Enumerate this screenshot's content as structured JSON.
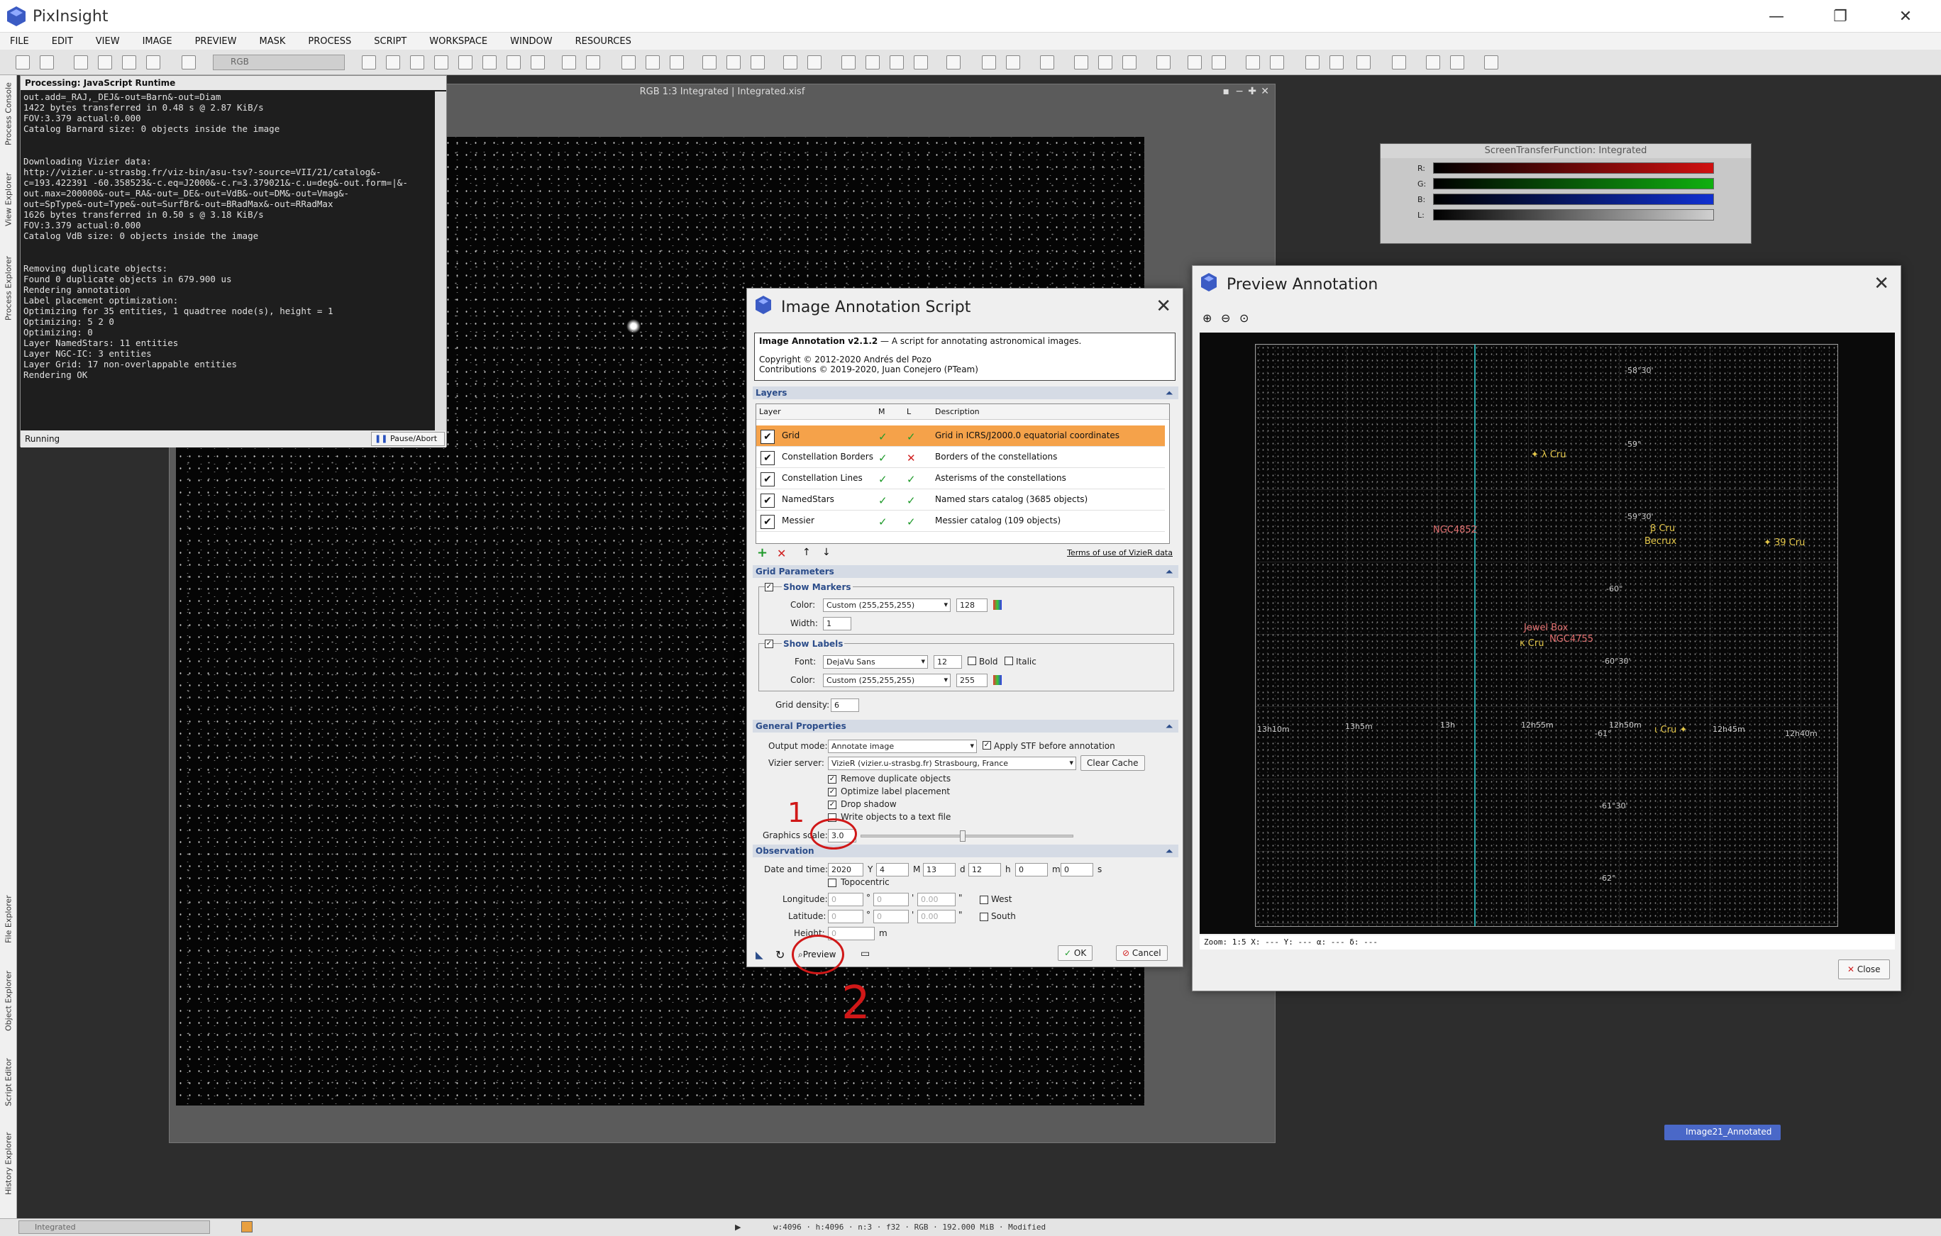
{
  "app": {
    "title": "PixInsight",
    "min": "—",
    "restore": "❐",
    "close": "✕"
  },
  "menu": [
    "FILE",
    "EDIT",
    "VIEW",
    "IMAGE",
    "PREVIEW",
    "MASK",
    "PROCESS",
    "SCRIPT",
    "WORKSPACE",
    "WINDOW",
    "RESOURCES"
  ],
  "toolbar": {
    "image_combo": "RGB"
  },
  "side_tabs": [
    "Process Console",
    "View Explorer",
    "Process Explorer",
    "File Explorer",
    "Object Explorer",
    "Script Editor",
    "History Explorer"
  ],
  "image_window": {
    "title": "RGB 1:3 Integrated | Integrated.xisf"
  },
  "console": {
    "title": "Processing: JavaScript Runtime",
    "text": "out.add=_RAJ,_DEJ&-out=Barn&-out=Diam\n1422 bytes transferred in 0.48 s @ 2.87 KiB/s\nFOV:3.379 actual:0.000\nCatalog Barnard size: 0 objects inside the image\n\n\nDownloading Vizier data:\nhttp://vizier.u-strasbg.fr/viz-bin/asu-tsv?-source=VII/21/catalog&-\nc=193.422391 -60.358523&-c.eq=J2000&-c.r=3.379021&-c.u=deg&-out.form=|&-\nout.max=200000&-out=_RA&-out=_DE&-out=VdB&-out=DM&-out=Vmag&-\nout=SpType&-out=Type&-out=SurfBr&-out=BRadMax&-out=RRadMax\n1626 bytes transferred in 0.50 s @ 3.18 KiB/s\nFOV:3.379 actual:0.000\nCatalog VdB size: 0 objects inside the image\n\n\nRemoving duplicate objects:\nFound 0 duplicate objects in 679.900 us\nRendering annotation\nLabel placement optimization:\nOptimizing for 35 entities, 1 quadtree node(s), height = 1\nOptimizing: 5 2 0\nOptimizing: 0\nLayer NamedStars: 11 entities\nLayer NGC-IC: 3 entities\nLayer Grid: 17 non-overlappable entities\nRendering OK",
    "status": "Running",
    "pause_label": "Pause/Abort"
  },
  "stf": {
    "title": "ScreenTransferFunction: Integrated",
    "channels": [
      "R:",
      "G:",
      "B:",
      "L:"
    ],
    "colors": [
      "#d01010",
      "#10b010",
      "#1030d0",
      "#d0d0d0"
    ]
  },
  "dialog": {
    "title": "Image Annotation Script",
    "close": "✕",
    "info_title": "Image Annotation v2.1.2",
    "info_desc": " — A script for annotating astronomical images.",
    "copyright1": "Copyright © 2012-2020 Andrés del Pozo",
    "copyright2": "Contributions © 2019-2020, Juan Conejero (PTeam)",
    "layers_hdr": "Layers",
    "cols": {
      "layer": "Layer",
      "m": "M",
      "l": "L",
      "desc": "Description"
    },
    "layers": [
      {
        "name": "Grid",
        "m": "✓",
        "l": "✓",
        "desc": "Grid in ICRS/J2000.0 equatorial coordinates"
      },
      {
        "name": "Constellation Borders",
        "m": "✓",
        "l": "✕",
        "desc": "Borders of the constellations"
      },
      {
        "name": "Constellation Lines",
        "m": "✓",
        "l": "✓",
        "desc": "Asterisms of the constellations"
      },
      {
        "name": "NamedStars",
        "m": "✓",
        "l": "✓",
        "desc": "Named stars catalog (3685 objects)"
      },
      {
        "name": "Messier",
        "m": "✓",
        "l": "✓",
        "desc": "Messier catalog (109 objects)"
      }
    ],
    "terms": "Terms of use of VizieR data",
    "grid_hdr": "Grid Parameters",
    "show_markers": "Show Markers",
    "color_lbl": "Color:",
    "marker_color": "Custom (255,255,255)",
    "marker_alpha": "128",
    "width_lbl": "Width:",
    "width_val": "1",
    "show_labels": "Show Labels",
    "font_lbl": "Font:",
    "font_val": "DejaVu Sans",
    "font_size": "12",
    "bold": "Bold",
    "italic": "Italic",
    "label_color": "Custom (255,255,255)",
    "label_alpha": "255",
    "density_lbl": "Grid density:",
    "density_val": "6",
    "gen_hdr": "General Properties",
    "output_lbl": "Output mode:",
    "output_val": "Annotate image",
    "apply_stf": "Apply STF before annotation",
    "vizier_lbl": "Vizier server:",
    "vizier_val": "VizieR (vizier.u-strasbg.fr) Strasbourg, France",
    "clear_cache": "Clear Cache",
    "remove_dup": "Remove duplicate objects",
    "optimize": "Optimize label placement",
    "drop_shadow": "Drop shadow",
    "write_text": "Write objects to a text file",
    "gscale_lbl": "Graphics scale:",
    "gscale_val": "3.0",
    "obs_hdr": "Observation",
    "date_lbl": "Date and time:",
    "year": "2020",
    "y": "Y",
    "month": "4",
    "mo": "M",
    "day": "13",
    "d": "d",
    "hour": "12",
    "h": "h",
    "minute": "0",
    "m": "m",
    "second": "0",
    "s": "s",
    "topocentric": "Topocentric",
    "lon_lbl": "Longitude:",
    "lat_lbl": "Latitude:",
    "height_lbl": "Height:",
    "zero": "0",
    "zerodec": "0.00",
    "deg": "°",
    "min_sym": "'",
    "sec_sym": "\"",
    "west": "West",
    "south": "South",
    "meters": "m",
    "preview_btn": "Preview",
    "ok_btn": "OK",
    "cancel_btn": "Cancel"
  },
  "preview": {
    "title": "Preview Annotation",
    "close": "✕",
    "status": "Zoom: 1:5     X: ---     Y: ---     α: ---     δ: ---",
    "close_btn": "Close",
    "dec_labels": [
      "-58°30'",
      "-59°",
      "-59°30'",
      "-60°",
      "-60°30'",
      "-61°",
      "-61°30'",
      "-62°"
    ],
    "ra_labels": [
      "13h10m",
      "13h5m",
      "13h",
      "12h55m",
      "12h50m",
      "12h45m",
      "12h40m"
    ],
    "stars": [
      "λ Cru",
      "β Cru",
      "Becrux",
      "39 Cru",
      "κ Cru",
      "ι Cru"
    ],
    "ngc": [
      "NGC4852",
      "Jewel Box",
      "NGC4755"
    ]
  },
  "statusbar": {
    "view": "Integrated",
    "info": "w:4096  ·  h:4096  ·  n:3  ·  f32  ·  RGB  ·  192.000 MiB  ·  Modified"
  },
  "task_item": "Image21_Annotated",
  "annotations": {
    "one": "1",
    "two": "2"
  }
}
